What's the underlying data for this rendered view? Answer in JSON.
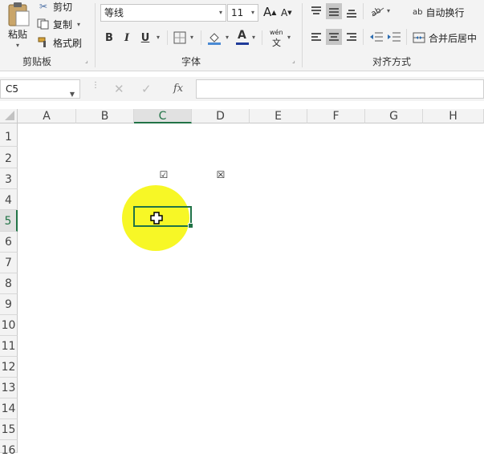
{
  "clipboard": {
    "paste": "粘贴",
    "cut": "剪切",
    "copy": "复制",
    "format_painter": "格式刷",
    "group": "剪贴板"
  },
  "font": {
    "family": "等线",
    "size": "11",
    "grow": "A",
    "shrink": "A",
    "bold": "B",
    "italic": "I",
    "underline": "U",
    "color_letter": "A",
    "phonetic_top": "wén",
    "phonetic_bottom": "文",
    "group": "字体"
  },
  "alignment": {
    "wrap_text": "自动换行",
    "merge_center": "合并后居中",
    "group": "对齐方式",
    "wrap_icon": "ab"
  },
  "formula_bar": {
    "name_box": "C5",
    "fx": "fx",
    "cancel": "✕",
    "enter": "✓",
    "value": ""
  },
  "sheet": {
    "columns": [
      "A",
      "B",
      "C",
      "D",
      "E",
      "F",
      "G",
      "H"
    ],
    "rows": [
      "1",
      "2",
      "3",
      "4",
      "5",
      "6",
      "7",
      "8",
      "9",
      "10",
      "11",
      "12",
      "13",
      "14",
      "15",
      "16"
    ],
    "selected_cell": "C5",
    "checkbox_checked": "☑",
    "checkbox_crossed": "☒"
  },
  "colors": {
    "accent": "#217346",
    "highlight": "#f6f600",
    "fill_bucket": "#4a8ad4",
    "font_color": "#1f3b99"
  }
}
